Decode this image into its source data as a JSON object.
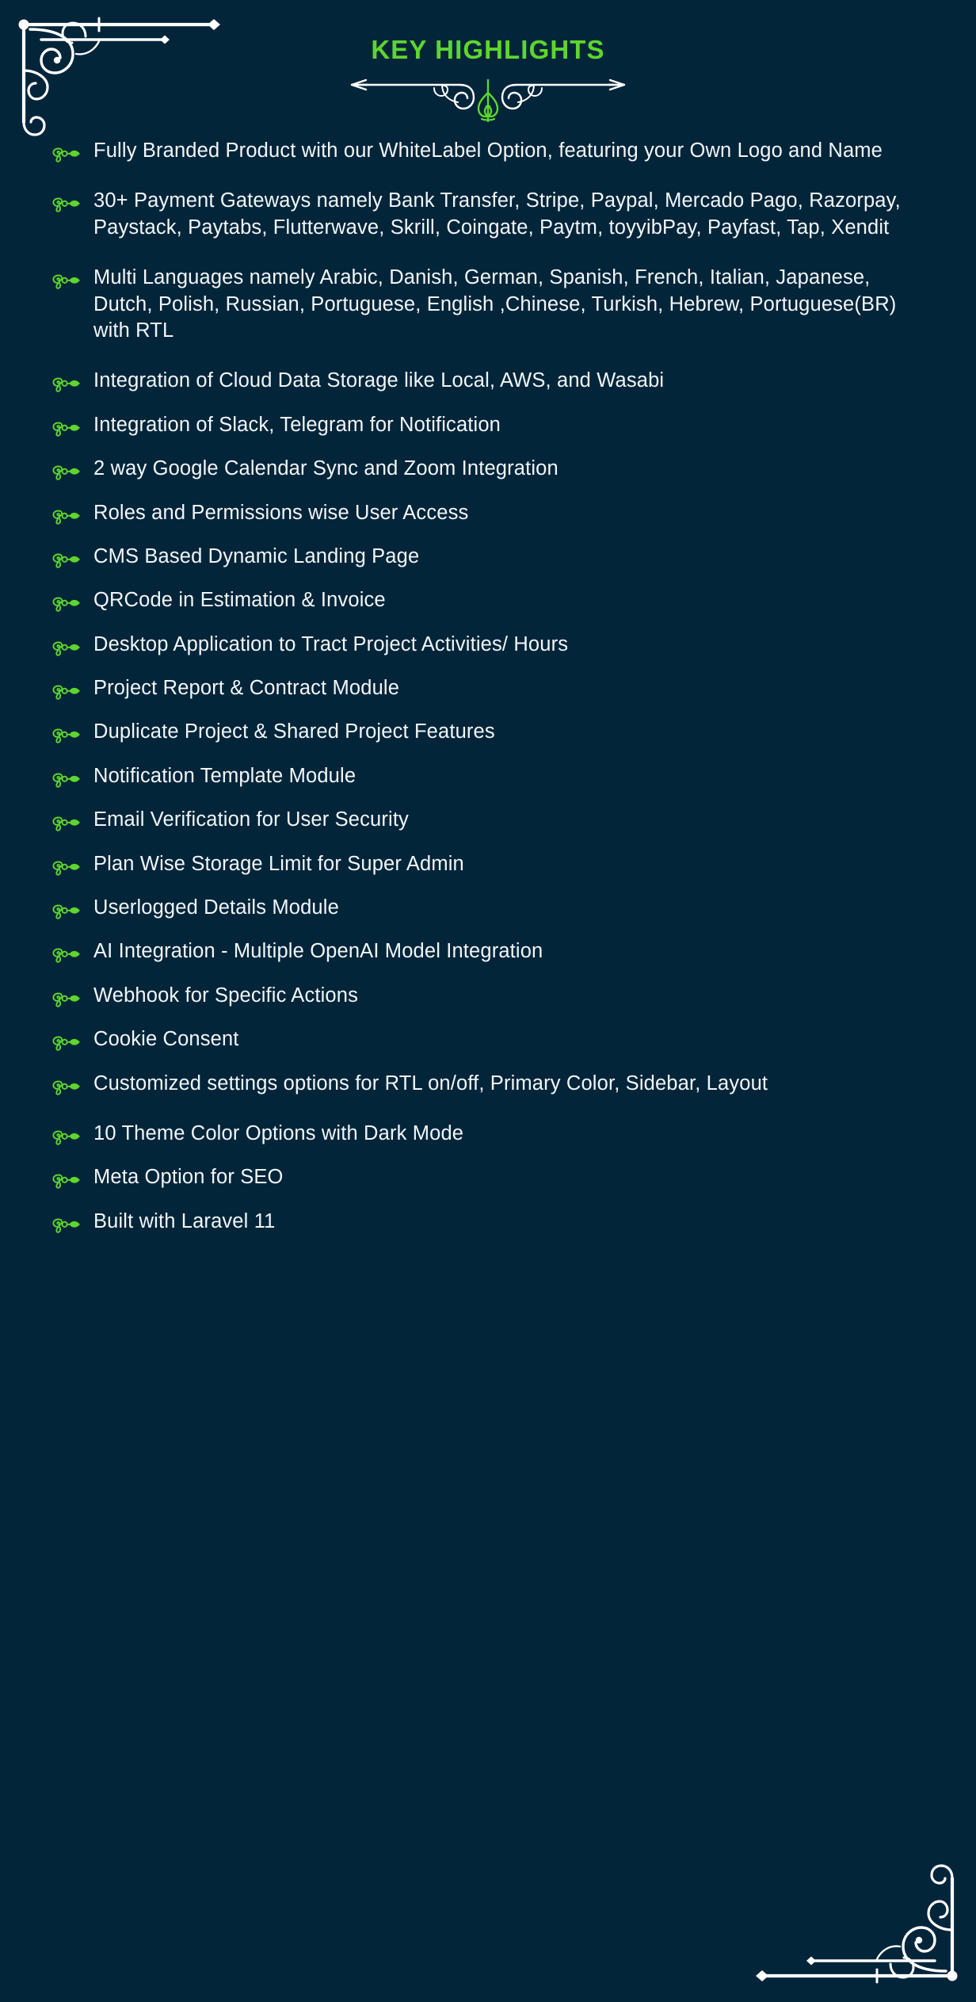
{
  "theme": {
    "background_color": "#03253a",
    "accent_color": "#5ed62d",
    "text_color": "#f2f6f8",
    "ornament_color": "#ffffff"
  },
  "header": {
    "title": "KEY HIGHLIGHTS",
    "divider_icon": "ornamental-flourish-divider"
  },
  "ornaments": {
    "top_left_icon": "corner-flourish-icon",
    "bottom_right_icon": "corner-flourish-icon"
  },
  "list": {
    "bullet_icon": "ornamental-arrow-bullet-icon",
    "items": [
      {
        "text": "Fully Branded Product with our WhiteLabel Option, featuring your Own Logo and Name",
        "lines": 2
      },
      {
        "text": "30+ Payment Gateways namely Bank Transfer, Stripe, Paypal, Mercado Pago, Razorpay, Paystack, Paytabs, Flutterwave, Skrill, Coingate, Paytm, toyyibPay, Payfast, Tap, Xendit",
        "lines": 3
      },
      {
        "text": "Multi Languages namely Arabic, Danish, German, Spanish, French, Italian, Japanese, Dutch, Polish, Russian, Portuguese, English ,Chinese, Turkish, Hebrew, Portuguese(BR) with RTL",
        "lines": 3
      },
      {
        "text": "Integration of Cloud Data Storage like Local, AWS, and Wasabi",
        "lines": 1
      },
      {
        "text": "Integration of Slack, Telegram for Notification",
        "lines": 1
      },
      {
        "text": "2 way Google Calendar Sync and Zoom Integration",
        "lines": 1
      },
      {
        "text": "Roles and Permissions wise User Access",
        "lines": 1
      },
      {
        "text": "CMS Based Dynamic Landing Page",
        "lines": 1
      },
      {
        "text": "QRCode in Estimation & Invoice",
        "lines": 1
      },
      {
        "text": "Desktop Application to Tract Project Activities/ Hours",
        "lines": 1
      },
      {
        "text": "Project Report & Contract Module",
        "lines": 1
      },
      {
        "text": "Duplicate Project & Shared Project Features",
        "lines": 1
      },
      {
        "text": "Notification Template Module",
        "lines": 1
      },
      {
        "text": "Email Verification for User Security",
        "lines": 1
      },
      {
        "text": "Plan Wise Storage Limit for Super Admin",
        "lines": 1
      },
      {
        "text": "Userlogged Details Module",
        "lines": 1
      },
      {
        "text": "AI Integration - Multiple OpenAI Model Integration",
        "lines": 1
      },
      {
        "text": "Webhook for Specific Actions",
        "lines": 1
      },
      {
        "text": "Cookie Consent",
        "lines": 1
      },
      {
        "text": "Customized settings options for RTL on/off, Primary Color, Sidebar, Layout",
        "lines": 2
      },
      {
        "text": "10 Theme Color Options with Dark Mode",
        "lines": 1
      },
      {
        "text": "Meta Option for SEO",
        "lines": 1
      },
      {
        "text": "Built with Laravel 11",
        "lines": 1
      }
    ]
  }
}
